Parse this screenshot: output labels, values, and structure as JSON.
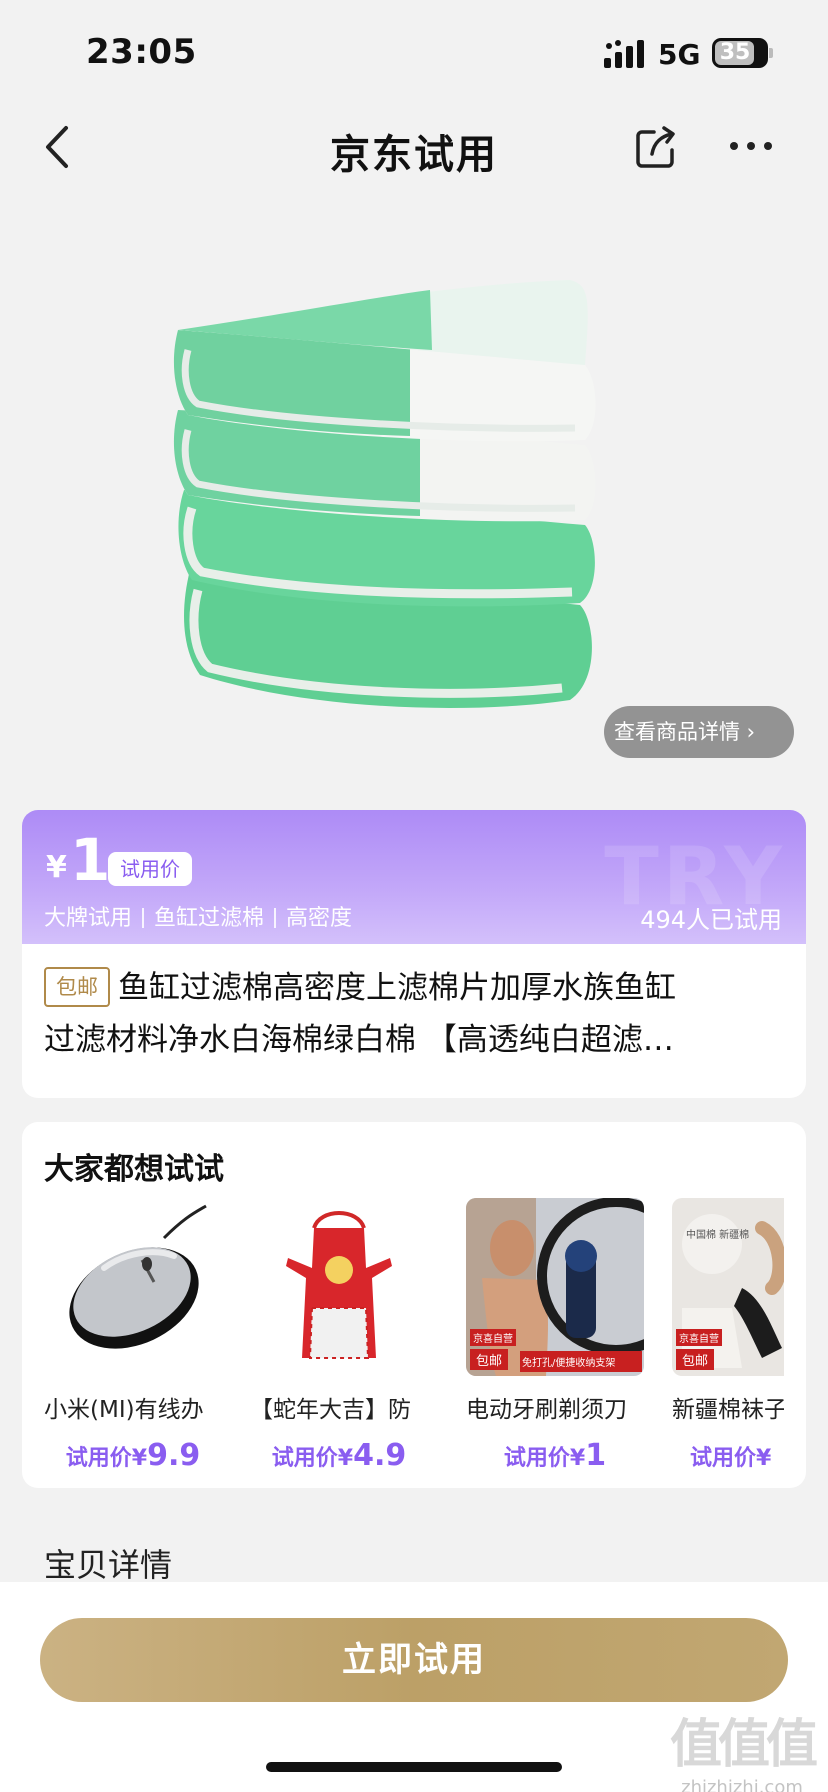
{
  "status_bar": {
    "time": "23:05",
    "network": "5G",
    "battery": "35"
  },
  "nav": {
    "title": "京东试用"
  },
  "product": {
    "details_link": "查看商品详情 ›",
    "price_symbol": "¥",
    "price": "1",
    "price_tag": "试用价",
    "tags": [
      "大牌试用",
      "鱼缸过滤棉",
      "高密度"
    ],
    "trial_count": "494人已试用",
    "shipping_badge": "包邮",
    "title_line1": "鱼缸过滤棉高密度上滤棉片加厚水族鱼缸",
    "title_line2": "过滤材料净水白海棉绿白棉 【高透纯白超滤…"
  },
  "recommend": {
    "heading": "大家都想试试",
    "items": [
      {
        "name": "小米(MI)有线办",
        "price_label": "试用价¥",
        "price": "9.9",
        "image": "mouse"
      },
      {
        "name": "【蛇年大吉】防",
        "price_label": "试用价¥",
        "price": "4.9",
        "image": "apron"
      },
      {
        "name": "电动牙刷剃须刀",
        "price_label": "试用价¥",
        "price": "1",
        "image": "shaver",
        "badge1": "京喜自营",
        "badge2": "包邮",
        "caption": "免打孔/便捷收纳支架"
      },
      {
        "name": "新疆棉袜子",
        "price_label": "试用价¥",
        "price": "",
        "image": "socks",
        "badge1": "京喜自营",
        "badge2": "包邮",
        "caption": "中国棉 新疆棉"
      }
    ]
  },
  "section_detail": "宝贝详情",
  "cta": {
    "label": "立即试用"
  },
  "watermark": {
    "main": "值值值",
    "sub": "zhizhizhi.com"
  },
  "colors": {
    "accent_purple": "#8a5df0",
    "gold": "#bca067"
  }
}
